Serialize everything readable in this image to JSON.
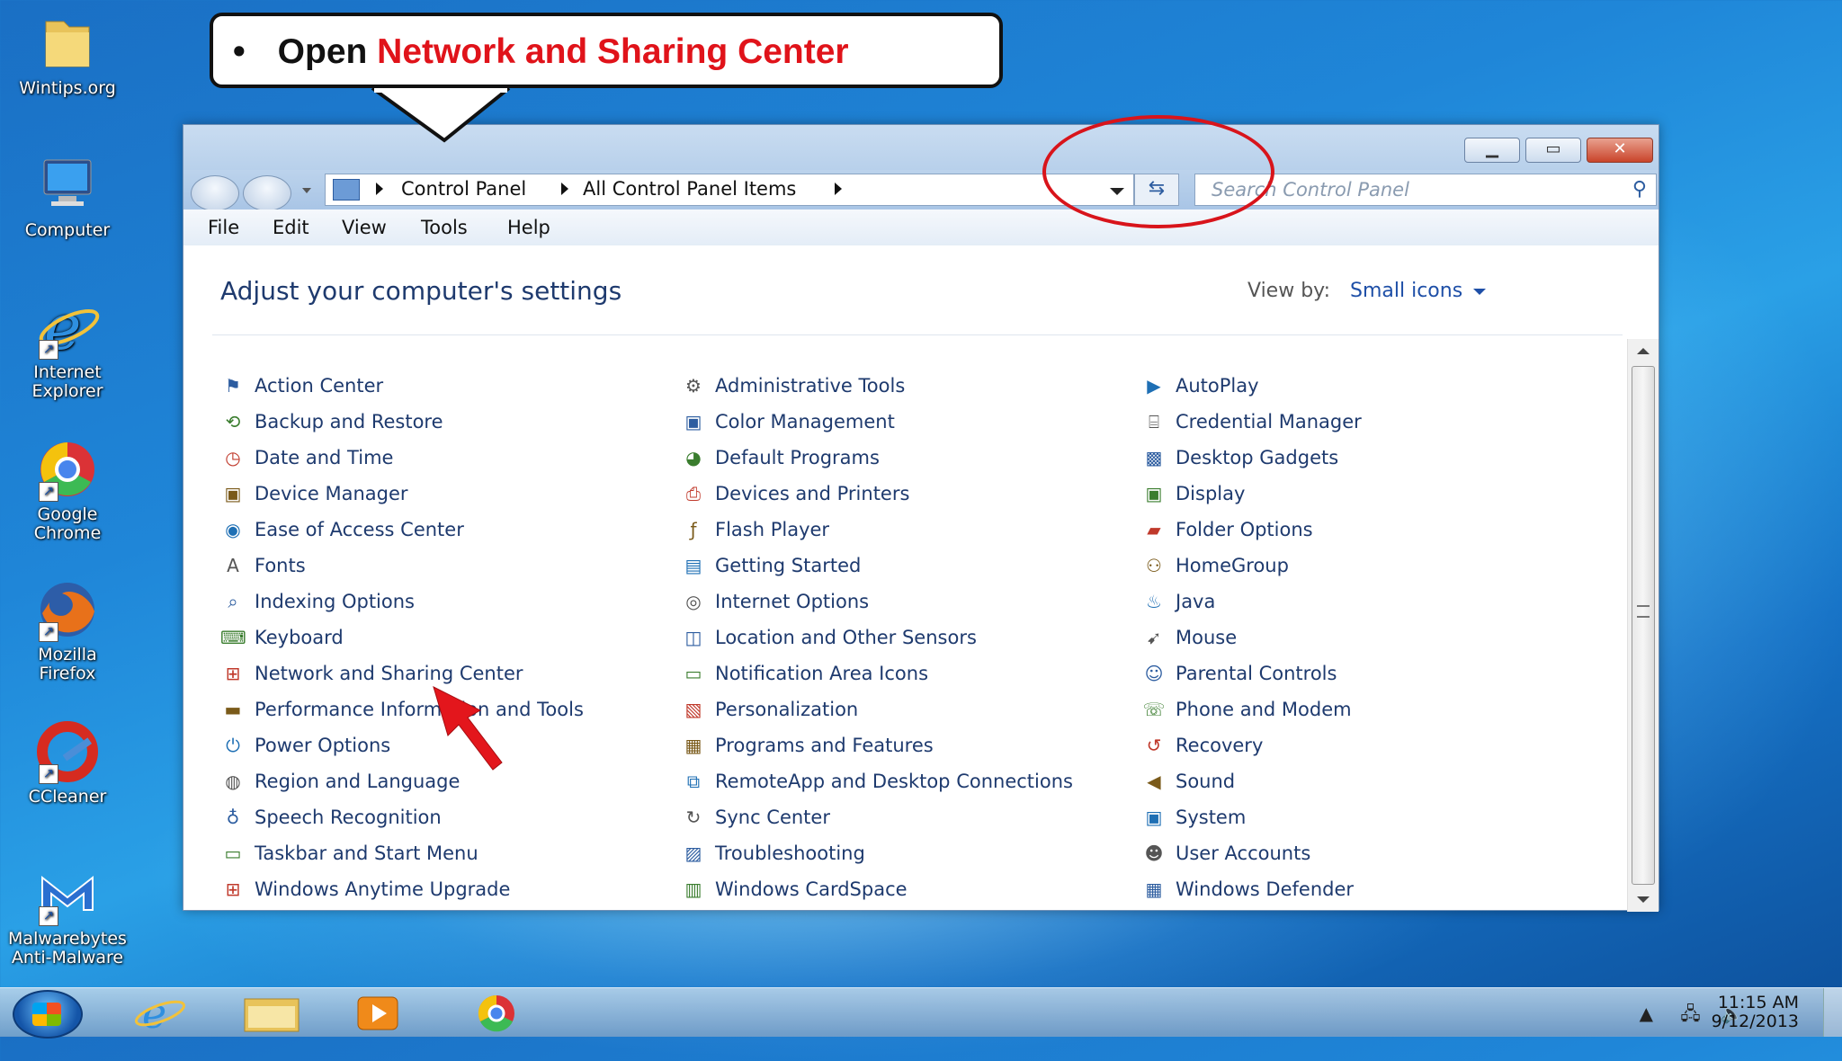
{
  "desktop_icons": [
    {
      "label": "Wintips.org",
      "icon": "folder-icon"
    },
    {
      "label": "Computer",
      "icon": "computer-icon"
    },
    {
      "label": "Internet Explorer",
      "icon": "internet-explorer-icon"
    },
    {
      "label": "Google Chrome",
      "icon": "chrome-icon"
    },
    {
      "label": "Mozilla Firefox",
      "icon": "firefox-icon"
    },
    {
      "label": "CCleaner",
      "icon": "ccleaner-icon"
    },
    {
      "label": "Malwarebytes Anti-Malware",
      "icon": "malwarebytes-icon"
    }
  ],
  "callout": {
    "bullet": "•",
    "prefix": "Open ",
    "highlight": "Network and Sharing Center"
  },
  "window": {
    "address": {
      "root": "Control Panel",
      "current": "All Control Panel Items"
    },
    "search_placeholder": "Search Control Panel",
    "menu": [
      "File",
      "Edit",
      "View",
      "Tools",
      "Help"
    ],
    "heading": "Adjust your computer's settings",
    "view_by_label": "View by:",
    "view_by_value": "Small icons",
    "columns": [
      [
        {
          "label": "Action Center",
          "icon": "flag-icon"
        },
        {
          "label": "Backup and Restore",
          "icon": "backup-icon"
        },
        {
          "label": "Date and Time",
          "icon": "clock-icon"
        },
        {
          "label": "Device Manager",
          "icon": "device-manager-icon"
        },
        {
          "label": "Ease of Access Center",
          "icon": "ease-of-access-icon"
        },
        {
          "label": "Fonts",
          "icon": "fonts-icon"
        },
        {
          "label": "Indexing Options",
          "icon": "indexing-icon"
        },
        {
          "label": "Keyboard",
          "icon": "keyboard-icon"
        },
        {
          "label": "Network and Sharing Center",
          "icon": "network-icon"
        },
        {
          "label": "Performance Information and Tools",
          "icon": "performance-icon"
        },
        {
          "label": "Power Options",
          "icon": "power-icon"
        },
        {
          "label": "Region and Language",
          "icon": "globe-icon"
        },
        {
          "label": "Speech Recognition",
          "icon": "microphone-icon"
        },
        {
          "label": "Taskbar and Start Menu",
          "icon": "taskbar-icon"
        },
        {
          "label": "Windows Anytime Upgrade",
          "icon": "windows-icon"
        }
      ],
      [
        {
          "label": "Administrative Tools",
          "icon": "admin-tools-icon"
        },
        {
          "label": "Color Management",
          "icon": "monitor-icon"
        },
        {
          "label": "Default Programs",
          "icon": "default-programs-icon"
        },
        {
          "label": "Devices and Printers",
          "icon": "printer-icon"
        },
        {
          "label": "Flash Player",
          "icon": "flash-icon"
        },
        {
          "label": "Getting Started",
          "icon": "getting-started-icon"
        },
        {
          "label": "Internet Options",
          "icon": "internet-options-icon"
        },
        {
          "label": "Location and Other Sensors",
          "icon": "sensors-icon"
        },
        {
          "label": "Notification Area Icons",
          "icon": "notification-icon"
        },
        {
          "label": "Personalization",
          "icon": "personalization-icon"
        },
        {
          "label": "Programs and Features",
          "icon": "programs-icon"
        },
        {
          "label": "RemoteApp and Desktop Connections",
          "icon": "remoteapp-icon"
        },
        {
          "label": "Sync Center",
          "icon": "sync-icon"
        },
        {
          "label": "Troubleshooting",
          "icon": "troubleshooting-icon"
        },
        {
          "label": "Windows CardSpace",
          "icon": "cardspace-icon"
        }
      ],
      [
        {
          "label": "AutoPlay",
          "icon": "autoplay-icon"
        },
        {
          "label": "Credential Manager",
          "icon": "credential-icon"
        },
        {
          "label": "Desktop Gadgets",
          "icon": "gadgets-icon"
        },
        {
          "label": "Display",
          "icon": "display-icon"
        },
        {
          "label": "Folder Options",
          "icon": "folder-options-icon"
        },
        {
          "label": "HomeGroup",
          "icon": "homegroup-icon"
        },
        {
          "label": "Java",
          "icon": "java-icon"
        },
        {
          "label": "Mouse",
          "icon": "mouse-icon"
        },
        {
          "label": "Parental Controls",
          "icon": "parental-icon"
        },
        {
          "label": "Phone and Modem",
          "icon": "phone-icon"
        },
        {
          "label": "Recovery",
          "icon": "recovery-icon"
        },
        {
          "label": "Sound",
          "icon": "speaker-icon"
        },
        {
          "label": "System",
          "icon": "system-icon"
        },
        {
          "label": "User Accounts",
          "icon": "users-icon"
        },
        {
          "label": "Windows Defender",
          "icon": "defender-icon"
        }
      ]
    ]
  },
  "taskbar": {
    "pinned": [
      "internet-explorer-icon",
      "explorer-icon",
      "media-player-icon",
      "chrome-icon"
    ],
    "time": "11:15 AM",
    "date": "9/12/2013"
  },
  "colors": {
    "highlight_red": "#e0131a",
    "link_blue": "#1e3a6e"
  }
}
